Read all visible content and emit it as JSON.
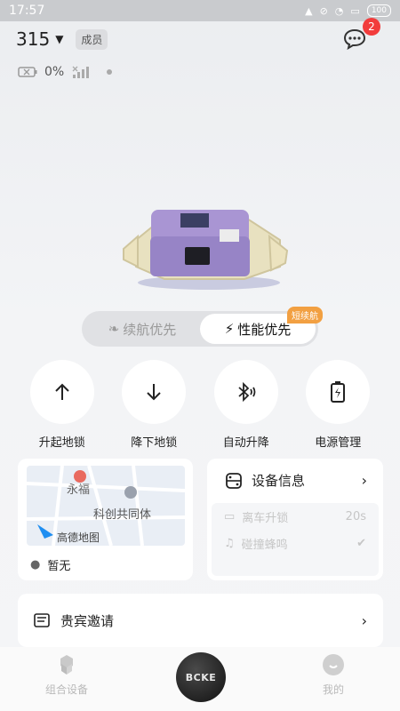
{
  "status_bar": {
    "time": "17:57",
    "battery": "100"
  },
  "header": {
    "device_id": "315",
    "role_badge": "成员",
    "message_count": "2"
  },
  "device_status": {
    "battery_percent": "0%"
  },
  "mode_toggle": {
    "options": [
      {
        "label": "续航优先",
        "active": false
      },
      {
        "label": "性能优先",
        "active": true
      }
    ],
    "tag": "短续航"
  },
  "actions": [
    {
      "label": "升起地锁",
      "icon": "arrow-up-icon"
    },
    {
      "label": "降下地锁",
      "icon": "arrow-down-icon"
    },
    {
      "label": "自动升降",
      "icon": "bluetooth-signal-icon"
    },
    {
      "label": "电源管理",
      "icon": "battery-charge-icon"
    }
  ],
  "map_card": {
    "map_labels": [
      "永福",
      "科创共同体"
    ],
    "map_brand": "高德地图",
    "location": "暂无"
  },
  "info_card": {
    "title": "设备信息",
    "rows": [
      {
        "label": "离车升锁",
        "value": "20s"
      },
      {
        "label": "碰撞蜂鸣",
        "value": ""
      }
    ]
  },
  "invite": {
    "label": "贵宾邀请"
  },
  "bottom_nav": {
    "left": "组合设备",
    "center": "BCKE",
    "right": "我的"
  }
}
